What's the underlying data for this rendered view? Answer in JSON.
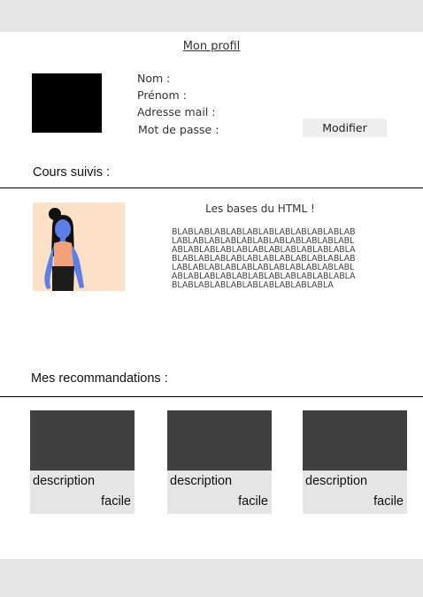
{
  "profile": {
    "title": "Mon profil",
    "fields": [
      "Nom :",
      "Prénom :",
      "Adresse mail :",
      "Mot de passe :"
    ],
    "modify_label": "Modifier"
  },
  "courses": {
    "heading": "Cours suivis :",
    "items": [
      {
        "title": "Les bases du HTML !",
        "description": "BLABLABLABLABLABLABLABLABLABLABLABLABLABLABLABLABLABLABLABLABLABLABLABLABLABLABLABLABLABLABLABLABLABLABLABLABLABLABLABLABLABLABLABLABLABLABLABLABLABLABLABLABLABLABLABLABLABLABLABLABLABLABLABLABLABLABLABLABLABLABLABLABLABLABLABLABLABLA"
      }
    ]
  },
  "recommendations": {
    "heading": "Mes recommandations :",
    "items": [
      {
        "description": "description",
        "level": "facile"
      },
      {
        "description": "description",
        "level": "facile"
      },
      {
        "description": "description",
        "level": "facile"
      }
    ]
  },
  "colors": {
    "bar": "#e5e5e5",
    "thumbnail": "#404040",
    "course_image_bg": "#fde0c8",
    "illustration_skin": "#5b7fe6"
  }
}
